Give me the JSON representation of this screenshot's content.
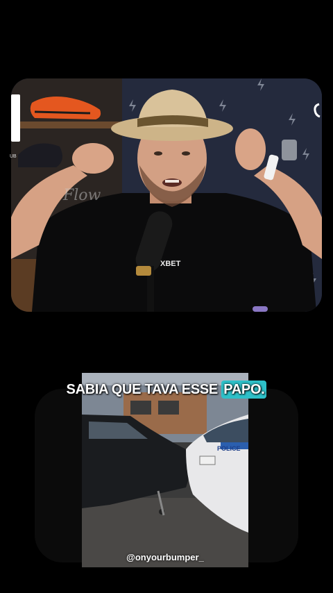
{
  "caption": {
    "text": "SABIA QUE TAVA ESSE",
    "highlight": "PAPO.",
    "highlight_color": "#2ec0c8"
  },
  "watermark": "@onyourbumper_",
  "top_video": {
    "mic_brand": "XBET",
    "shelf_text": "Flow",
    "side_text": "UB"
  },
  "bottom_video": {
    "car_label": "POLICE"
  }
}
